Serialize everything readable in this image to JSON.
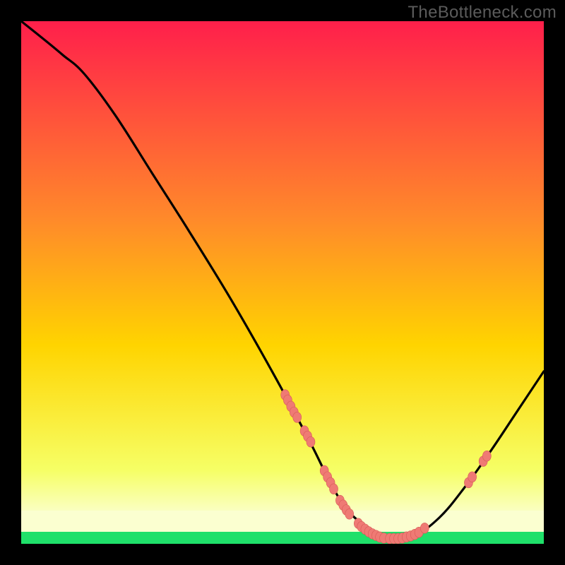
{
  "watermark": "TheBottleneck.com",
  "chart_data": {
    "type": "line",
    "title": "",
    "xlabel": "",
    "ylabel": "",
    "xlim": [
      0,
      100
    ],
    "ylim": [
      0,
      100
    ],
    "grid": false,
    "legend": false,
    "series": [
      {
        "name": "curve",
        "x": [
          0,
          5,
          8,
          12,
          18,
          25,
          32,
          40,
          48,
          55,
          59,
          62,
          65,
          68,
          70,
          75,
          80,
          85,
          90,
          95,
          100
        ],
        "y": [
          100,
          96,
          93.5,
          90,
          82,
          71,
          60,
          47,
          33,
          20,
          12,
          7,
          4,
          2,
          1,
          1.5,
          5,
          11,
          18,
          25.5,
          33
        ]
      }
    ],
    "markers": {
      "name": "clusters",
      "points": [
        {
          "x": 50.5,
          "y": 28.5
        },
        {
          "x": 51.0,
          "y": 27.5
        },
        {
          "x": 51.6,
          "y": 26.3
        },
        {
          "x": 52.2,
          "y": 25.2
        },
        {
          "x": 52.8,
          "y": 24.2
        },
        {
          "x": 54.2,
          "y": 21.6
        },
        {
          "x": 54.8,
          "y": 20.6
        },
        {
          "x": 55.4,
          "y": 19.5
        },
        {
          "x": 58.0,
          "y": 14.0
        },
        {
          "x": 58.6,
          "y": 12.8
        },
        {
          "x": 59.2,
          "y": 11.7
        },
        {
          "x": 59.8,
          "y": 10.5
        },
        {
          "x": 61.0,
          "y": 8.3
        },
        {
          "x": 61.6,
          "y": 7.4
        },
        {
          "x": 62.2,
          "y": 6.5
        },
        {
          "x": 62.8,
          "y": 5.7
        },
        {
          "x": 64.5,
          "y": 3.9
        },
        {
          "x": 65.1,
          "y": 3.3
        },
        {
          "x": 65.8,
          "y": 2.8
        },
        {
          "x": 66.5,
          "y": 2.3
        },
        {
          "x": 67.2,
          "y": 1.9
        },
        {
          "x": 67.9,
          "y": 1.6
        },
        {
          "x": 68.6,
          "y": 1.3
        },
        {
          "x": 69.4,
          "y": 1.1
        },
        {
          "x": 70.5,
          "y": 1.0
        },
        {
          "x": 71.3,
          "y": 1.0
        },
        {
          "x": 72.1,
          "y": 1.0
        },
        {
          "x": 72.9,
          "y": 1.1
        },
        {
          "x": 73.7,
          "y": 1.3
        },
        {
          "x": 74.5,
          "y": 1.5
        },
        {
          "x": 75.3,
          "y": 1.8
        },
        {
          "x": 76.1,
          "y": 2.2
        },
        {
          "x": 77.2,
          "y": 3.0
        },
        {
          "x": 85.6,
          "y": 11.7
        },
        {
          "x": 86.3,
          "y": 12.8
        },
        {
          "x": 88.4,
          "y": 15.8
        },
        {
          "x": 89.1,
          "y": 16.8
        }
      ]
    },
    "colors": {
      "background_gradient_top": "#ff1f4b",
      "background_gradient_mid": "#ffd400",
      "background_gradient_low": "#f6ff66",
      "band_pale": "#fbffd0",
      "band_green": "#1fe06a",
      "curve": "#000000",
      "marker_fill": "#ef7a74",
      "marker_stroke": "#d65a56"
    }
  }
}
